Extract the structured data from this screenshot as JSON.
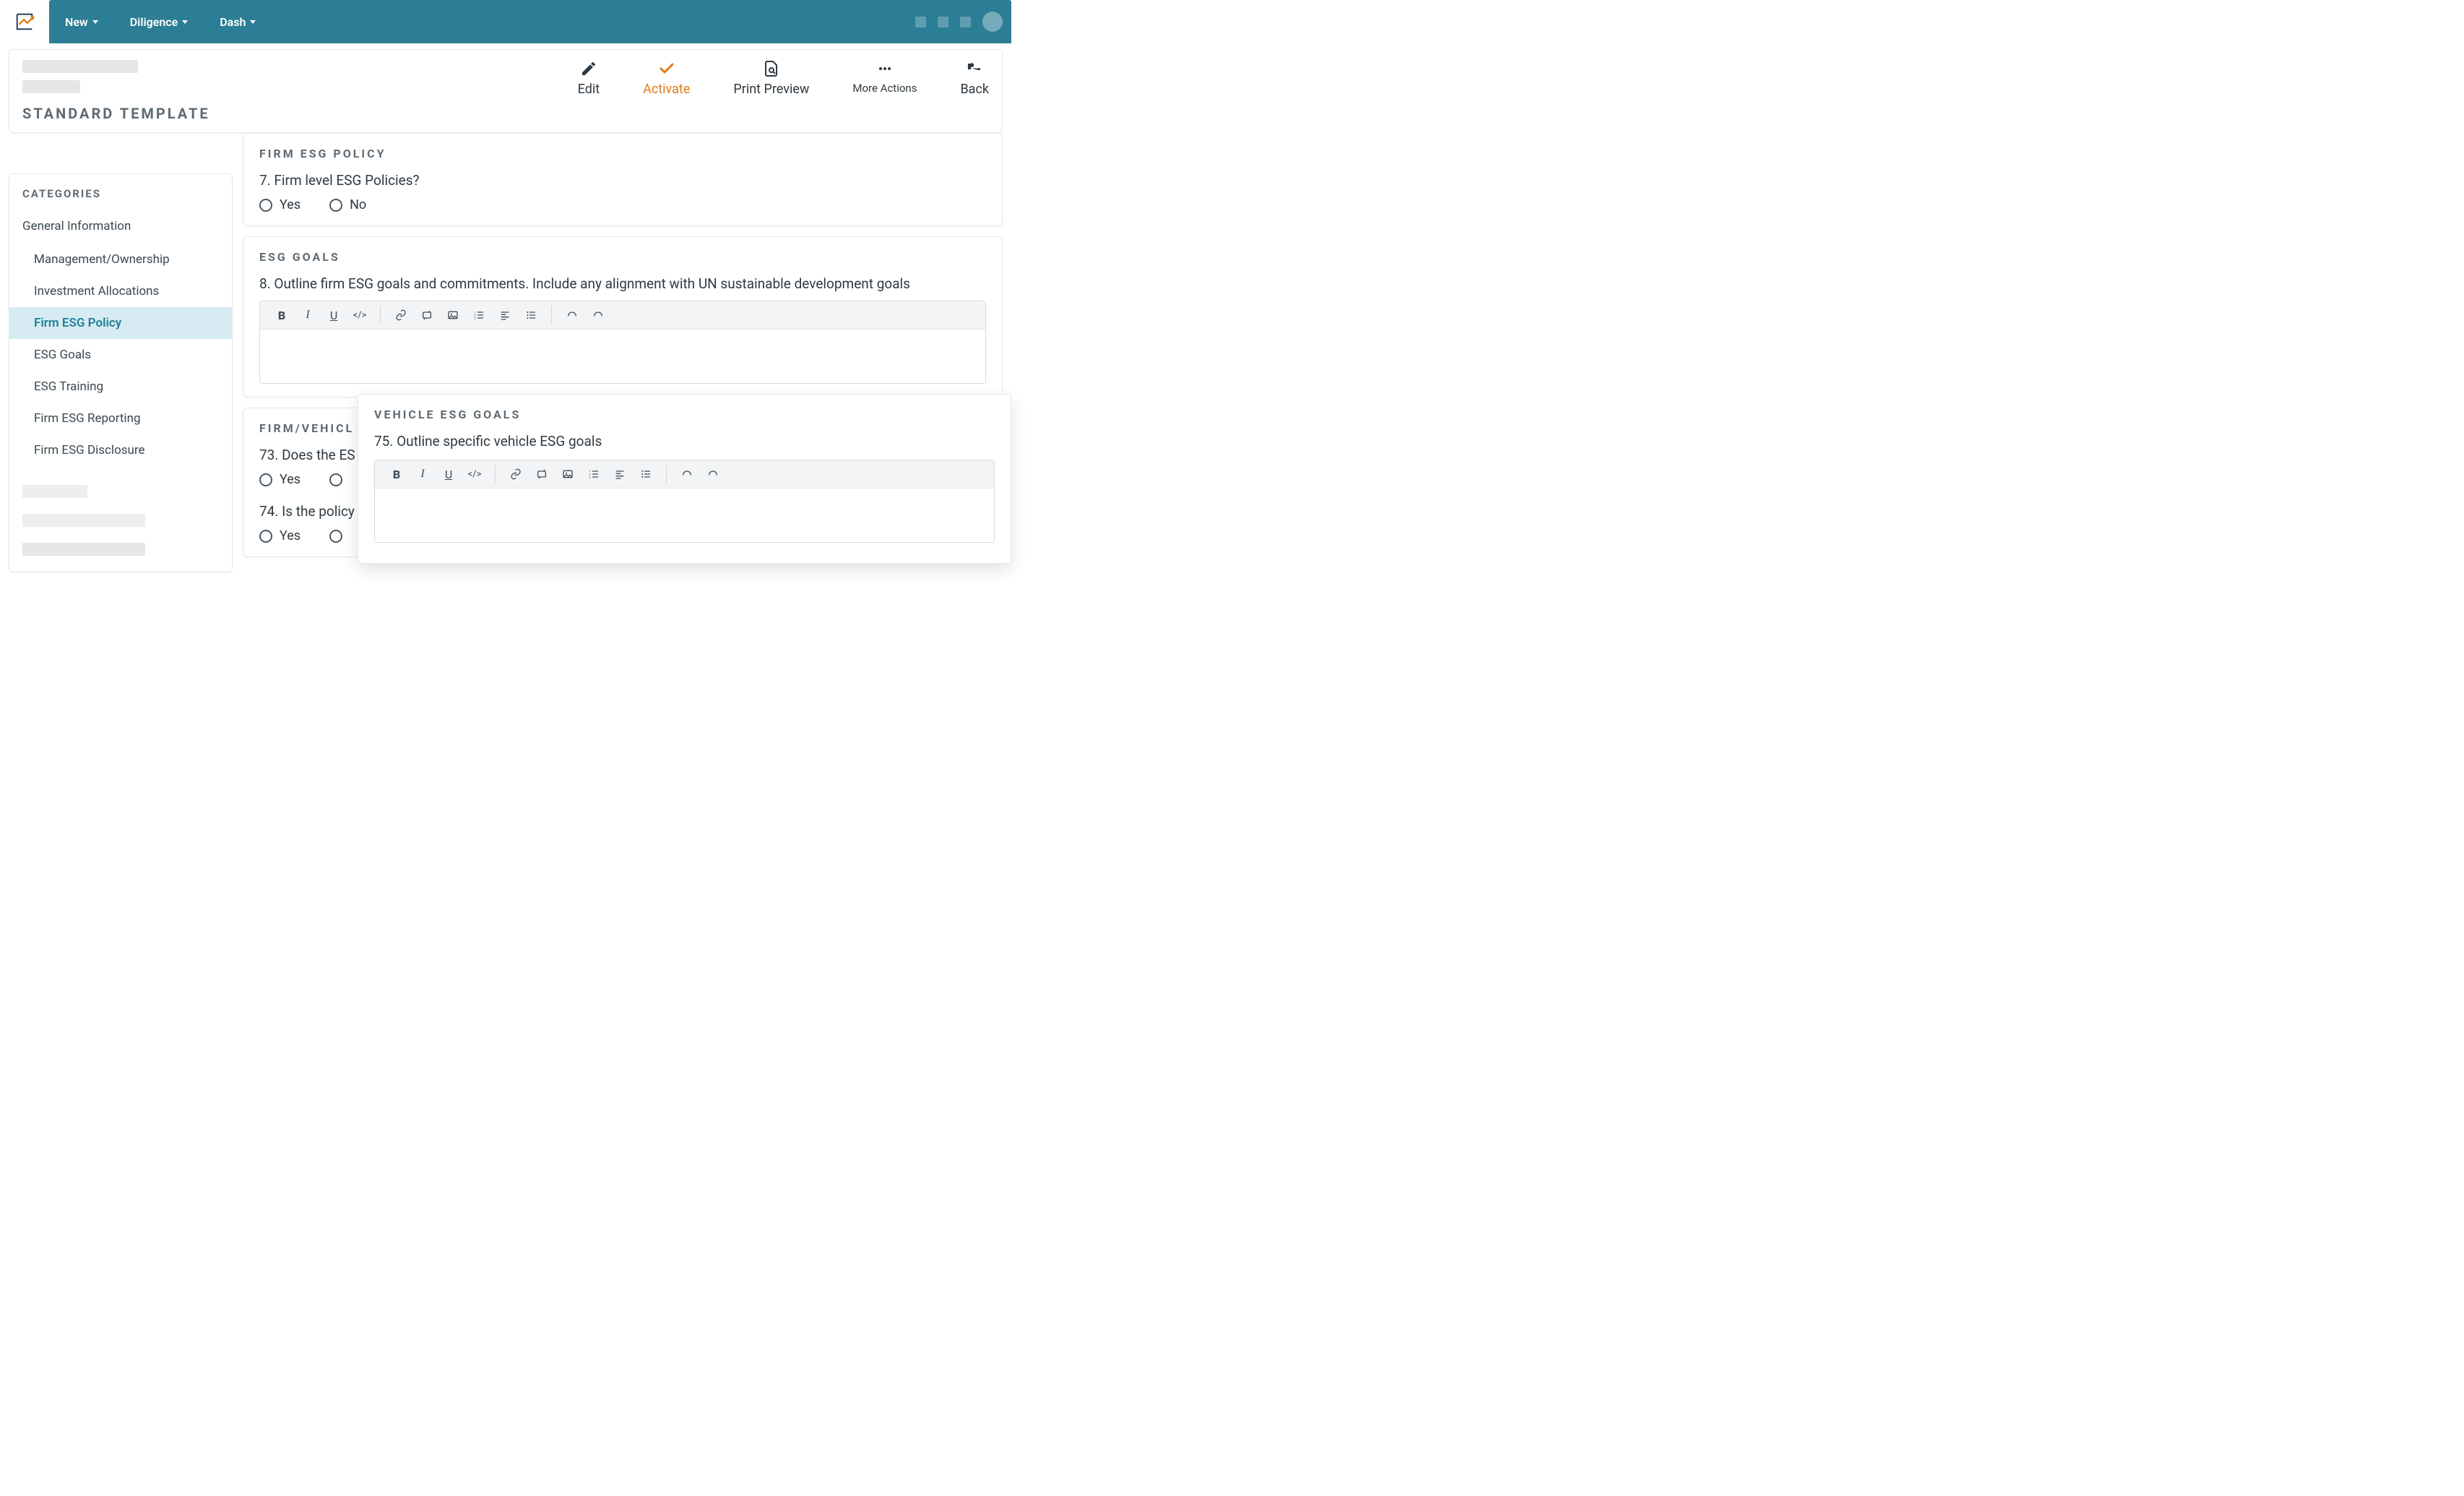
{
  "topnav": {
    "items": [
      "New",
      "Diligence",
      "Dash"
    ]
  },
  "header": {
    "title": "STANDARD TEMPLATE",
    "actions": {
      "edit": "Edit",
      "activate": "Activate",
      "print_preview": "Print Preview",
      "more_actions": "More Actions",
      "back": "Back"
    }
  },
  "categories": {
    "title": "CATEGORIES",
    "top": "General Information",
    "items": [
      "Management/Ownership",
      "Investment Allocations",
      "Firm ESG Policy",
      "ESG Goals",
      "ESG Training",
      "Firm ESG Reporting",
      "Firm ESG Disclosure"
    ],
    "active_index": 2
  },
  "cards": {
    "firm_policy": {
      "section": "FIRM ESG POLICY",
      "q": "7. Firm level ESG Policies?",
      "yes": "Yes",
      "no": "No"
    },
    "esg_goals": {
      "section": "ESG GOALS",
      "q": "8. Outline firm ESG goals and commitments. Include any alignment with UN sustainable development goals"
    },
    "firm_vehicle": {
      "section": "FIRM/VEHICL",
      "q73": "73. Does the ES",
      "q74": "74. Is the policy",
      "yes": "Yes"
    },
    "vehicle_goals": {
      "section": "VEHICLE ESG GOALS",
      "q": "75. Outline specific vehicle ESG goals"
    }
  },
  "rte": {
    "bold": "B",
    "italic": "I",
    "underline": "U",
    "code": "</>"
  }
}
